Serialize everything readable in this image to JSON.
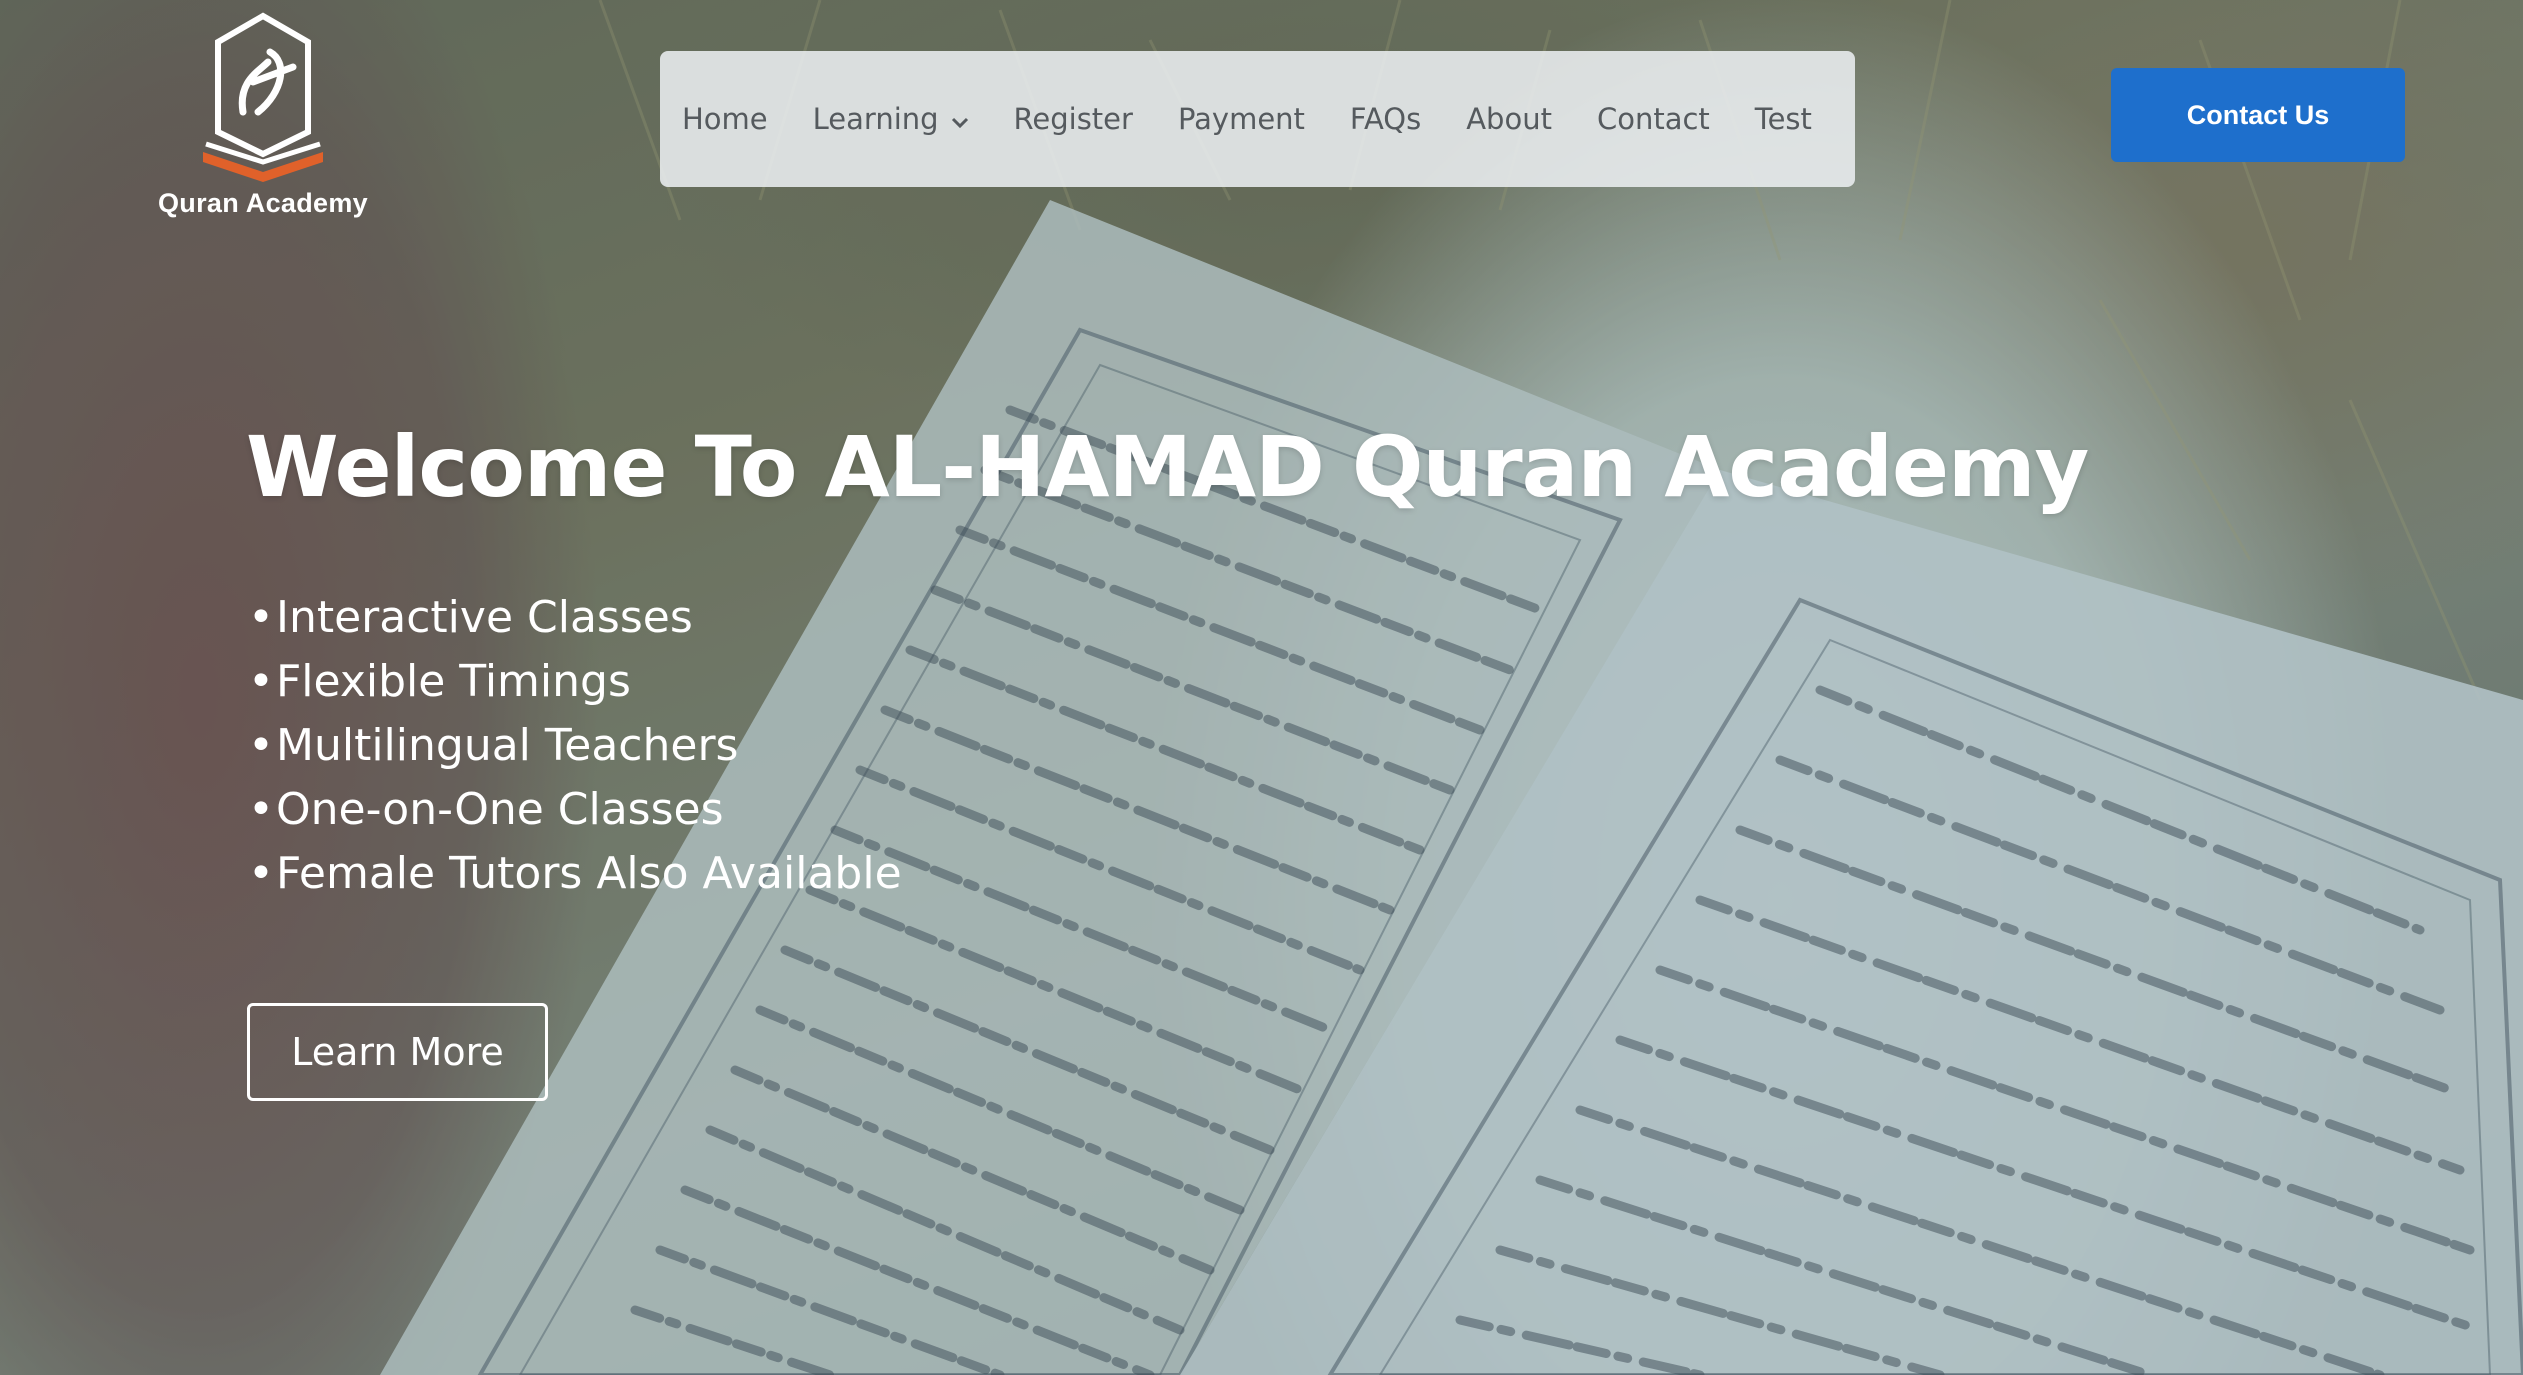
{
  "brand": {
    "logo_text": "Quran Academy"
  },
  "nav": {
    "items": [
      {
        "label": "Home"
      },
      {
        "label": "Learning"
      },
      {
        "label": "Register"
      },
      {
        "label": "Payment"
      },
      {
        "label": "FAQs"
      },
      {
        "label": "About"
      },
      {
        "label": "Contact"
      },
      {
        "label": "Test"
      }
    ]
  },
  "header": {
    "contact_button": "Contact Us"
  },
  "hero": {
    "title": "Welcome To AL-HAMAD Quran Academy",
    "features": [
      "Interactive Classes",
      "Flexible Timings",
      "Multilingual Teachers",
      "One-on-One Classes",
      "Female Tutors Also Available"
    ],
    "bullet": "•",
    "cta": "Learn More"
  },
  "colors": {
    "primary_button": "#1e6fcc",
    "logo_accent": "#e0612a",
    "text_on_hero": "#ffffff",
    "nav_text": "#555a5e"
  },
  "icons": {
    "dropdown": "chevron-down-icon",
    "logo": "book-calligraphy-logo"
  }
}
